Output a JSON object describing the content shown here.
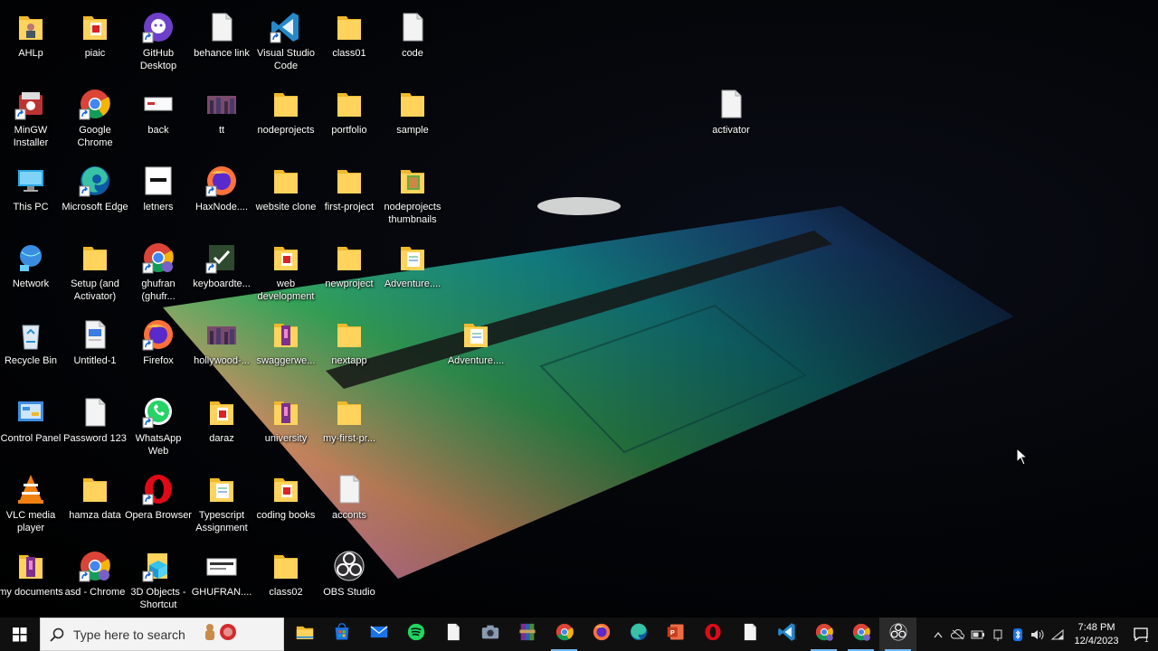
{
  "desktop": {
    "icons": [
      {
        "label": "AHLp",
        "type": "folder-user"
      },
      {
        "label": "piaic",
        "type": "folder-pdf"
      },
      {
        "label": "GitHub Desktop",
        "type": "github"
      },
      {
        "label": "behance link",
        "type": "doc"
      },
      {
        "label": "Visual Studio Code",
        "type": "vscode"
      },
      {
        "label": "class01",
        "type": "folder"
      },
      {
        "label": "code",
        "type": "doc"
      },
      {
        "label": "MinGW Installer",
        "type": "mingw"
      },
      {
        "label": "Google Chrome",
        "type": "chrome"
      },
      {
        "label": "back",
        "type": "image"
      },
      {
        "label": "tt",
        "type": "image-city"
      },
      {
        "label": "nodeprojects",
        "type": "folder"
      },
      {
        "label": "portfolio",
        "type": "folder"
      },
      {
        "label": "sample",
        "type": "folder"
      },
      {
        "label": "activator",
        "type": "doc"
      },
      {
        "label": "This PC",
        "type": "pc"
      },
      {
        "label": "Microsoft Edge",
        "type": "edge"
      },
      {
        "label": "letners",
        "type": "image-white"
      },
      {
        "label": "HaxNode....",
        "type": "firefox-shortcut"
      },
      {
        "label": "website clone",
        "type": "folder"
      },
      {
        "label": "first-project",
        "type": "folder"
      },
      {
        "label": "nodeprojects thumbnails",
        "type": "folder-img"
      },
      {
        "label": "Network",
        "type": "network"
      },
      {
        "label": "Setup (and Activator)",
        "type": "folder"
      },
      {
        "label": "ghufran (ghufr...",
        "type": "chrome-user"
      },
      {
        "label": "keyboardte...",
        "type": "task"
      },
      {
        "label": "web development",
        "type": "folder-pdf"
      },
      {
        "label": "newproject",
        "type": "folder"
      },
      {
        "label": "Adventure....",
        "type": "folder-doc"
      },
      {
        "label": "Recycle Bin",
        "type": "recycle"
      },
      {
        "label": "Untitled-1",
        "type": "doc-blue"
      },
      {
        "label": "Firefox",
        "type": "firefox"
      },
      {
        "label": "hollywood-...",
        "type": "image-city"
      },
      {
        "label": "swaggerwe...",
        "type": "folder-book"
      },
      {
        "label": "nextapp",
        "type": "folder"
      },
      {
        "label": "Adventure....",
        "type": "folder-doc"
      },
      {
        "label": "Control Panel",
        "type": "control"
      },
      {
        "label": "Password 123",
        "type": "doc"
      },
      {
        "label": "WhatsApp Web",
        "type": "whatsapp"
      },
      {
        "label": "daraz",
        "type": "folder-pdf"
      },
      {
        "label": "university",
        "type": "folder-book"
      },
      {
        "label": "my-first-pr...",
        "type": "folder"
      },
      {
        "label": "VLC media player",
        "type": "vlc"
      },
      {
        "label": "hamza data",
        "type": "folder"
      },
      {
        "label": "Opera Browser",
        "type": "opera"
      },
      {
        "label": "Typescript Assignment",
        "type": "folder-doc"
      },
      {
        "label": "coding books",
        "type": "folder-pdf"
      },
      {
        "label": "acconts",
        "type": "doc"
      },
      {
        "label": "my documents",
        "type": "folder-book"
      },
      {
        "label": "asd - Chrome",
        "type": "chrome-user"
      },
      {
        "label": "3D Objects - Shortcut",
        "type": "3d"
      },
      {
        "label": "GHUFRAN....",
        "type": "image-doc"
      },
      {
        "label": "class02",
        "type": "folder"
      },
      {
        "label": "OBS Studio",
        "type": "obs"
      }
    ]
  },
  "taskbar": {
    "search_placeholder": "Type here to search",
    "apps": [
      {
        "name": "file-explorer",
        "state": ""
      },
      {
        "name": "microsoft-store",
        "state": ""
      },
      {
        "name": "mail",
        "state": ""
      },
      {
        "name": "spotify",
        "state": ""
      },
      {
        "name": "notepad",
        "state": ""
      },
      {
        "name": "camera",
        "state": ""
      },
      {
        "name": "winrar",
        "state": ""
      },
      {
        "name": "chrome",
        "state": "running"
      },
      {
        "name": "firefox",
        "state": ""
      },
      {
        "name": "edge",
        "state": ""
      },
      {
        "name": "powerpoint",
        "state": ""
      },
      {
        "name": "opera",
        "state": ""
      },
      {
        "name": "notepad-2",
        "state": ""
      },
      {
        "name": "vscode",
        "state": ""
      },
      {
        "name": "chrome-user",
        "state": "running"
      },
      {
        "name": "chrome-user-2",
        "state": "running"
      },
      {
        "name": "obs",
        "state": "active"
      }
    ],
    "clock_time": "7:48 PM",
    "clock_date": "12/4/2023",
    "notification_count": "1"
  },
  "colors": {
    "taskbar_bg": "#101010",
    "active_indicator": "#76b9ed",
    "folder": "#f0b92a"
  }
}
